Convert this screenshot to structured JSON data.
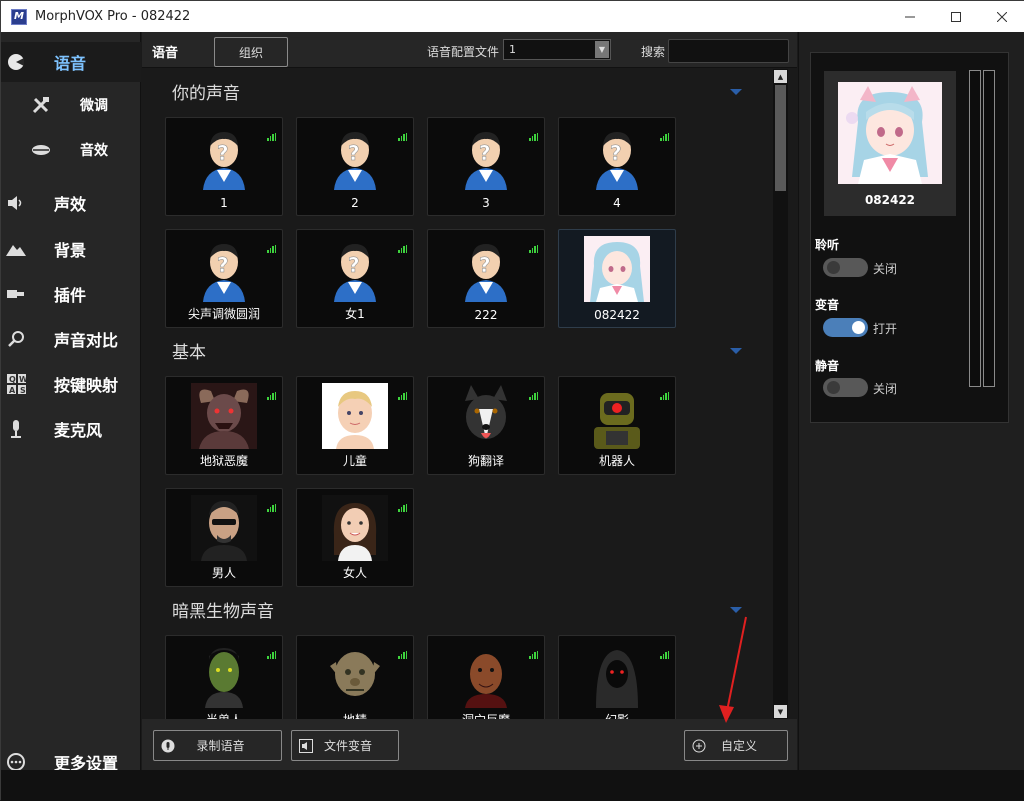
{
  "window": {
    "title": "MorphVOX Pro - 082422",
    "logo": "M"
  },
  "sidebar": {
    "items": [
      {
        "label": "语音",
        "icon": "voice-icon",
        "active": true
      },
      {
        "label": "微调",
        "icon": "tools-icon",
        "sub": true
      },
      {
        "label": "音效",
        "icon": "lips-icon",
        "sub": true
      },
      {
        "label": "声效",
        "icon": "speaker-icon"
      },
      {
        "label": "背景",
        "icon": "mountain-icon"
      },
      {
        "label": "插件",
        "icon": "plugin-icon"
      },
      {
        "label": "声音对比",
        "icon": "magnifier-icon"
      },
      {
        "label": "按键映射",
        "icon": "keyboard-icon"
      },
      {
        "label": "麦克风",
        "icon": "microphone-icon"
      },
      {
        "label": "更多设置",
        "icon": "more-icon"
      }
    ]
  },
  "topbar": {
    "title": "语音",
    "group_button": "组织",
    "profile_label": "语音配置文件",
    "profile_value": "1",
    "search_label": "搜索",
    "search_value": ""
  },
  "sections": [
    {
      "title": "你的声音",
      "voices": [
        {
          "name": "1",
          "type": "unknown"
        },
        {
          "name": "2",
          "type": "unknown"
        },
        {
          "name": "3",
          "type": "unknown"
        },
        {
          "name": "4",
          "type": "unknown"
        },
        {
          "name": "尖声调微圆润",
          "type": "unknown"
        },
        {
          "name": "女1",
          "type": "unknown"
        },
        {
          "name": "222",
          "type": "unknown"
        },
        {
          "name": "082422",
          "type": "anime",
          "selected": true
        }
      ]
    },
    {
      "title": "基本",
      "voices": [
        {
          "name": "地狱恶魔",
          "type": "demon"
        },
        {
          "name": "儿童",
          "type": "child"
        },
        {
          "name": "狗翻译",
          "type": "dog"
        },
        {
          "name": "机器人",
          "type": "robot"
        },
        {
          "name": "男人",
          "type": "man"
        },
        {
          "name": "女人",
          "type": "woman"
        }
      ]
    },
    {
      "title": "暗黑生物声音",
      "voices": [
        {
          "name": "半兽人",
          "type": "orc"
        },
        {
          "name": "地精",
          "type": "goblin"
        },
        {
          "name": "洞穴巨魔",
          "type": "troll"
        },
        {
          "name": "幻影",
          "type": "phantom"
        }
      ]
    }
  ],
  "bottombar": {
    "record_label": "录制语音",
    "file_label": "文件变音",
    "custom_label": "自定义"
  },
  "right_panel": {
    "current_voice": "082422",
    "listen": {
      "label": "聆听",
      "state": "关闭",
      "on": false
    },
    "morph": {
      "label": "变音",
      "state": "打开",
      "on": true
    },
    "mute": {
      "label": "静音",
      "state": "关闭",
      "on": false
    }
  },
  "colors": {
    "accent": "#7ec3ff",
    "toggle_on": "#4b7fb9",
    "signal": "#3ed43e",
    "annotation": "#e02020"
  }
}
